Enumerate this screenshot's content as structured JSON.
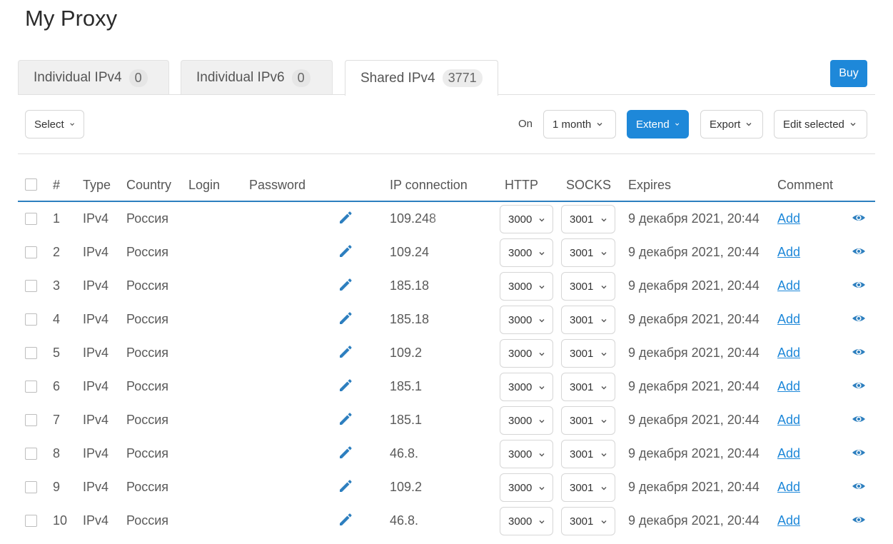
{
  "page": {
    "title": "My Proxy"
  },
  "tabs": [
    {
      "label": "Individual IPv4",
      "count": "0"
    },
    {
      "label": "Individual IPv6",
      "count": "0"
    },
    {
      "label": "Shared IPv4",
      "count": "3771",
      "active": true
    }
  ],
  "buy_label": "Buy",
  "toolbar": {
    "select_label": "Select",
    "on_label": "On",
    "period_value": "1 month",
    "extend_label": "Extend",
    "export_label": "Export",
    "edit_selected_label": "Edit selected"
  },
  "table": {
    "columns": [
      "#",
      "Type",
      "Country",
      "Login",
      "Password",
      "IP connection",
      "HTTP",
      "SOCKS",
      "Expires",
      "Comment"
    ],
    "rows": [
      {
        "num": "1",
        "type": "IPv4",
        "country": "Россия",
        "ip": "109.248",
        "http": "3000",
        "socks": "3001",
        "expires": "9 декабря 2021, 20:44",
        "comment": "Add"
      },
      {
        "num": "2",
        "type": "IPv4",
        "country": "Россия",
        "ip": "109.24",
        "http": "3000",
        "socks": "3001",
        "expires": "9 декабря 2021, 20:44",
        "comment": "Add"
      },
      {
        "num": "3",
        "type": "IPv4",
        "country": "Россия",
        "ip": "185.18",
        "http": "3000",
        "socks": "3001",
        "expires": "9 декабря 2021, 20:44",
        "comment": "Add"
      },
      {
        "num": "4",
        "type": "IPv4",
        "country": "Россия",
        "ip": "185.18",
        "http": "3000",
        "socks": "3001",
        "expires": "9 декабря 2021, 20:44",
        "comment": "Add"
      },
      {
        "num": "5",
        "type": "IPv4",
        "country": "Россия",
        "ip": "109.2",
        "http": "3000",
        "socks": "3001",
        "expires": "9 декабря 2021, 20:44",
        "comment": "Add"
      },
      {
        "num": "6",
        "type": "IPv4",
        "country": "Россия",
        "ip": "185.1",
        "http": "3000",
        "socks": "3001",
        "expires": "9 декабря 2021, 20:44",
        "comment": "Add"
      },
      {
        "num": "7",
        "type": "IPv4",
        "country": "Россия",
        "ip": "185.1",
        "http": "3000",
        "socks": "3001",
        "expires": "9 декабря 2021, 20:44",
        "comment": "Add"
      },
      {
        "num": "8",
        "type": "IPv4",
        "country": "Россия",
        "ip": "46.8.",
        "http": "3000",
        "socks": "3001",
        "expires": "9 декабря 2021, 20:44",
        "comment": "Add"
      },
      {
        "num": "9",
        "type": "IPv4",
        "country": "Россия",
        "ip": "109.2",
        "http": "3000",
        "socks": "3001",
        "expires": "9 декабря 2021, 20:44",
        "comment": "Add"
      },
      {
        "num": "10",
        "type": "IPv4",
        "country": "Россия",
        "ip": "46.8.",
        "http": "3000",
        "socks": "3001",
        "expires": "9 декабря 2021, 20:44",
        "comment": "Add"
      }
    ]
  },
  "colors": {
    "accent": "#1e88d9",
    "header_line": "#2d7fbf"
  },
  "icons": {
    "edit": "pencil-icon",
    "view": "eye-icon",
    "dropdown": "chevron-down-icon"
  }
}
